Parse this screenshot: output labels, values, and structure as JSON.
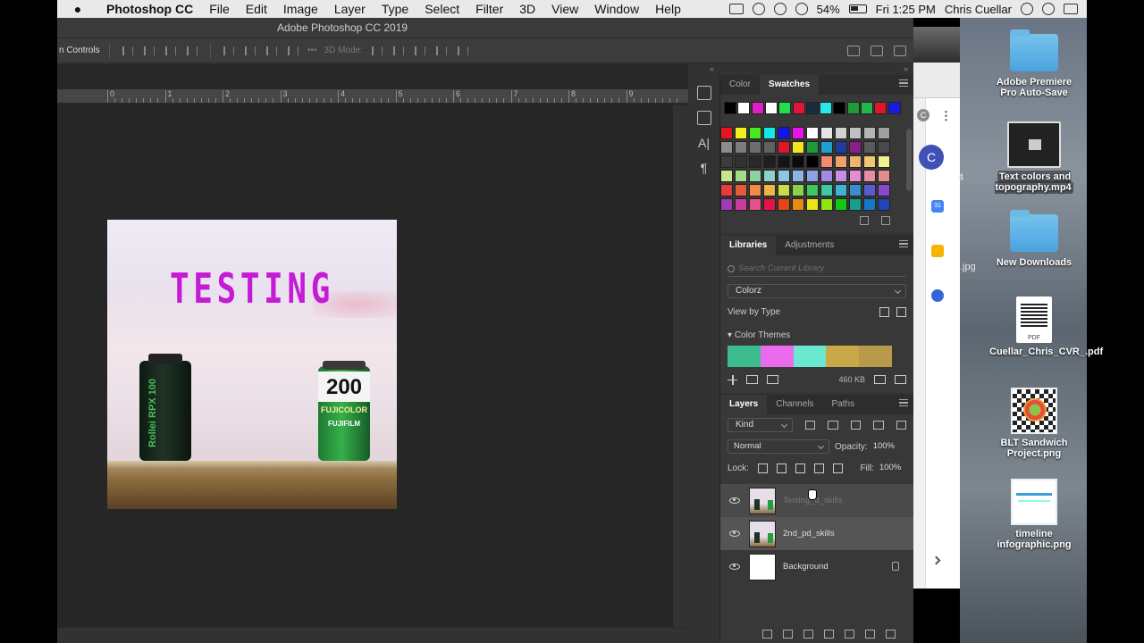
{
  "menubar": {
    "app": "Photoshop CC",
    "items": [
      "File",
      "Edit",
      "Image",
      "Layer",
      "Type",
      "Select",
      "Filter",
      "3D",
      "View",
      "Window",
      "Help"
    ],
    "battery": "54%",
    "clock": "Fri 1:25 PM",
    "user": "Chris Cuellar"
  },
  "photoshop": {
    "window_title": "Adobe Photoshop CC 2019",
    "options_bar": {
      "label": "n Controls",
      "mode_label": "3D Mode:"
    },
    "ruler_numbers": [
      "0",
      "1",
      "2",
      "3",
      "4",
      "5",
      "6",
      "7",
      "8",
      "9"
    ],
    "document": {
      "text": "TESTING",
      "canister_left_text": "Rollei RPX 100",
      "canister_right_number": "200",
      "canister_right_brand": "FUJICOLOR",
      "canister_right_brand2": "FUJIFILM"
    }
  },
  "swatches_panel": {
    "tabs": [
      "Color",
      "Swatches"
    ],
    "active_tab": "Swatches",
    "top_row": [
      "#000000",
      "#ffffff",
      "#e01ec8",
      "#ffffff",
      "#22e04a",
      "#e0143c",
      "#1a2b3c",
      "#28e8e8",
      "#000000",
      "#1e9a3a",
      "#22b84a",
      "#e0142c",
      "#1a1ae0"
    ],
    "grid": [
      [
        "#e8141e",
        "#f0f01e",
        "#46e81e",
        "#14e8e8",
        "#1414e8",
        "#e814e8",
        "#ffffff",
        "#e6e6e6",
        "#d2d2d2",
        "#c0c0c0",
        "#b4b4b4",
        "#a0a0a0"
      ],
      [
        "#8c8c8c",
        "#7d7d7d",
        "#6e6e6e",
        "#606060",
        "#e0142c",
        "#f0e61e",
        "#1e9a3a",
        "#1ea0d2",
        "#1e3ca0",
        "#8c1e8c",
        "#5a5a5a",
        "#4a4a4a"
      ],
      [
        "#3c3c3c",
        "#323232",
        "#282828",
        "#1e1e1e",
        "#141414",
        "#0a0a0a",
        "#000000",
        "#f08c6e",
        "#f0a06e",
        "#f0b46e",
        "#f0c86e",
        "#f0f08c"
      ],
      [
        "#c8e68c",
        "#a0dc8c",
        "#8cd2a0",
        "#8cd2c8",
        "#8cc8e6",
        "#8cb4e6",
        "#8ca0e6",
        "#a08ce6",
        "#c88ce6",
        "#e68cd2",
        "#e68ca0",
        "#e68c8c"
      ],
      [
        "#e63c3c",
        "#e65a3c",
        "#f08c46",
        "#f0b446",
        "#c8dc46",
        "#8cd246",
        "#3cc85a",
        "#3cc8a0",
        "#3cb4d2",
        "#3c8cd2",
        "#5a5ad2",
        "#8c46d2"
      ],
      [
        "#a03cb4",
        "#c83ca0",
        "#e6508c",
        "#e61446",
        "#e64614",
        "#e68c14",
        "#e6e614",
        "#8ce614",
        "#14c814",
        "#14a08c",
        "#1478c8",
        "#1e46b4"
      ]
    ]
  },
  "libraries_panel": {
    "tabs": [
      "Libraries",
      "Adjustments"
    ],
    "active_tab": "Libraries",
    "search_placeholder": "Search Current Library",
    "library": "Colorz",
    "view_by": "View by Type",
    "section": "Color Themes",
    "theme_colors": [
      "#3cbc8c",
      "#ea6cec",
      "#6ae8d0",
      "#c8a848",
      "#b89a4a"
    ],
    "size": "460 KB"
  },
  "layers_panel": {
    "tabs": [
      "Layers",
      "Channels",
      "Paths"
    ],
    "active_tab": "Layers",
    "kind": "Kind",
    "blend_mode": "Normal",
    "opacity_label": "Opacity:",
    "opacity": "100%",
    "lock_label": "Lock:",
    "fill_label": "Fill:",
    "fill": "100%",
    "layers": [
      {
        "name": "Testing_d_skills",
        "state": "dragging"
      },
      {
        "name": "2nd_pd_skills",
        "state": "selected"
      },
      {
        "name": "Background",
        "state": "locked"
      }
    ]
  },
  "browser": {
    "badge": "C",
    "avatar": "C",
    "calendar": "31"
  },
  "desktop": {
    "peek_labels": [
      "4",
      ".jpg"
    ],
    "icons": [
      {
        "label": "Adobe Premiere Pro Auto-Save",
        "kind": "folder"
      },
      {
        "label": "Text colors and topography.mp4",
        "kind": "video"
      },
      {
        "label": "New Downloads",
        "kind": "folder"
      },
      {
        "label": "Cuellar_Chris_CVR_.pdf",
        "kind": "pdf",
        "tag": "PDF"
      },
      {
        "label": "BLT Sandwich Project.png",
        "kind": "png"
      },
      {
        "label": "timeline infographic.png",
        "kind": "png"
      }
    ]
  }
}
